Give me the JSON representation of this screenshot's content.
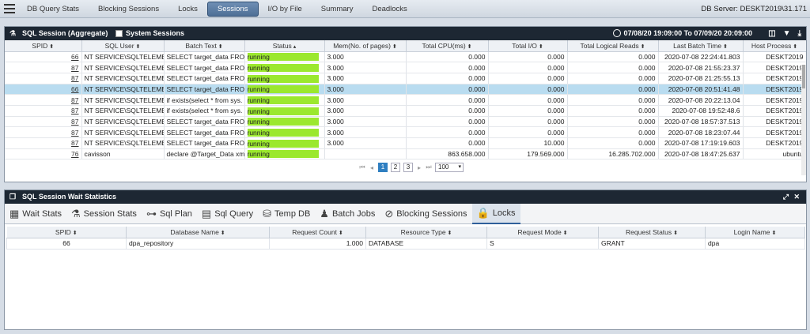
{
  "nav": {
    "tabs": [
      "DB Query Stats",
      "Blocking Sessions",
      "Locks",
      "Sessions",
      "I/O by File",
      "Summary",
      "Deadlocks"
    ],
    "active": "Sessions",
    "db_server": "DB Server: DESKT2019\\31.171"
  },
  "session_panel": {
    "title": "SQL Session (Aggregate)",
    "system_sessions_label": "System Sessions",
    "time_range": "07/08/20 19:09:00 To 07/09/20 20:09:00",
    "columns": [
      "SPID",
      "SQL User",
      "Batch Text",
      "Status",
      "Mem(No. of pages)",
      "Total CPU(ms)",
      "Total I/O",
      "Total Logical Reads",
      "Last Batch Time",
      "Host Process"
    ],
    "rows": [
      {
        "spid": "66",
        "user": "NT SERVICE\\SQLTELEMETR",
        "batch": "SELECT target_data FROM",
        "status": "running",
        "mem": "3.000",
        "cpu": "0.000",
        "io": "0.000",
        "reads": "0.000",
        "time": "2020-07-08 22:24:41.803",
        "host": "DESKT2019"
      },
      {
        "spid": "87",
        "user": "NT SERVICE\\SQLTELEMETR",
        "batch": "SELECT target_data FROM",
        "status": "running",
        "mem": "3.000",
        "cpu": "0.000",
        "io": "0.000",
        "reads": "0.000",
        "time": "2020-07-08 21:55:23.37",
        "host": "DESKT2019"
      },
      {
        "spid": "87",
        "user": "NT SERVICE\\SQLTELEMETR",
        "batch": "SELECT target_data FROM",
        "status": "running",
        "mem": "3.000",
        "cpu": "0.000",
        "io": "0.000",
        "reads": "0.000",
        "time": "2020-07-08 21:25:55.13",
        "host": "DESKT2019"
      },
      {
        "spid": "66",
        "user": "NT SERVICE\\SQLTELEMETR",
        "batch": "SELECT target_data FROM",
        "status": "running",
        "mem": "3.000",
        "cpu": "0.000",
        "io": "0.000",
        "reads": "0.000",
        "time": "2020-07-08 20:51:41.48",
        "host": "DESKT2019"
      },
      {
        "spid": "87",
        "user": "NT SERVICE\\SQLTELEMETR",
        "batch": "if exists(select * from sys.",
        "status": "running",
        "mem": "3.000",
        "cpu": "0.000",
        "io": "0.000",
        "reads": "0.000",
        "time": "2020-07-08 20:22:13.04",
        "host": "DESKT2019"
      },
      {
        "spid": "87",
        "user": "NT SERVICE\\SQLTELEMETR",
        "batch": "if exists(select * from sys.",
        "status": "running",
        "mem": "3.000",
        "cpu": "0.000",
        "io": "0.000",
        "reads": "0.000",
        "time": "2020-07-08 19:52:48.6",
        "host": "DESKT2019"
      },
      {
        "spid": "87",
        "user": "NT SERVICE\\SQLTELEMETR",
        "batch": "SELECT target_data FROM",
        "status": "running",
        "mem": "3.000",
        "cpu": "0.000",
        "io": "0.000",
        "reads": "0.000",
        "time": "2020-07-08 18:57:37.513",
        "host": "DESKT2019"
      },
      {
        "spid": "87",
        "user": "NT SERVICE\\SQLTELEMETR",
        "batch": "SELECT target_data FROM",
        "status": "running",
        "mem": "3.000",
        "cpu": "0.000",
        "io": "0.000",
        "reads": "0.000",
        "time": "2020-07-08 18:23:07.44",
        "host": "DESKT2019"
      },
      {
        "spid": "87",
        "user": "NT SERVICE\\SQLTELEMETR",
        "batch": "SELECT target_data FROM",
        "status": "running",
        "mem": "3.000",
        "cpu": "0.000",
        "io": "10.000",
        "reads": "0.000",
        "time": "2020-07-08 17:19:19.603",
        "host": "DESKT2019"
      },
      {
        "spid": "76",
        "user": "cavisson",
        "batch": "declare @Target_Data xml",
        "status": "running",
        "mem": "",
        "cpu": "863.658.000",
        "io": "179.569.000",
        "reads": "16.285.702.000",
        "time": "2020-07-08 18:47:25.637",
        "host": "ubuntu"
      }
    ],
    "selected_row": 3,
    "pages": [
      "1",
      "2",
      "3"
    ],
    "current_page": "1",
    "page_size": "100"
  },
  "wait_panel": {
    "title": "SQL Session Wait Statistics",
    "subtabs": [
      {
        "label": "Wait Stats",
        "icon": "chart-icon"
      },
      {
        "label": "Session Stats",
        "icon": "flask-icon"
      },
      {
        "label": "Sql Plan",
        "icon": "hierarchy-icon"
      },
      {
        "label": "Sql Query",
        "icon": "document-icon"
      },
      {
        "label": "Temp DB",
        "icon": "database-icon"
      },
      {
        "label": "Batch Jobs",
        "icon": "users-icon"
      },
      {
        "label": "Blocking Sessions",
        "icon": "blocked-icon"
      },
      {
        "label": "Locks",
        "icon": "lock-icon"
      }
    ],
    "active_subtab": "Locks",
    "columns": [
      "SPID",
      "Database Name",
      "Request Count",
      "Resource Type",
      "Request Mode",
      "Request Status",
      "Login Name"
    ],
    "rows": [
      {
        "spid": "66",
        "db": "dpa_repository",
        "count": "1.000",
        "type": "DATABASE",
        "mode": "S",
        "status": "GRANT",
        "login": "dpa"
      }
    ]
  }
}
